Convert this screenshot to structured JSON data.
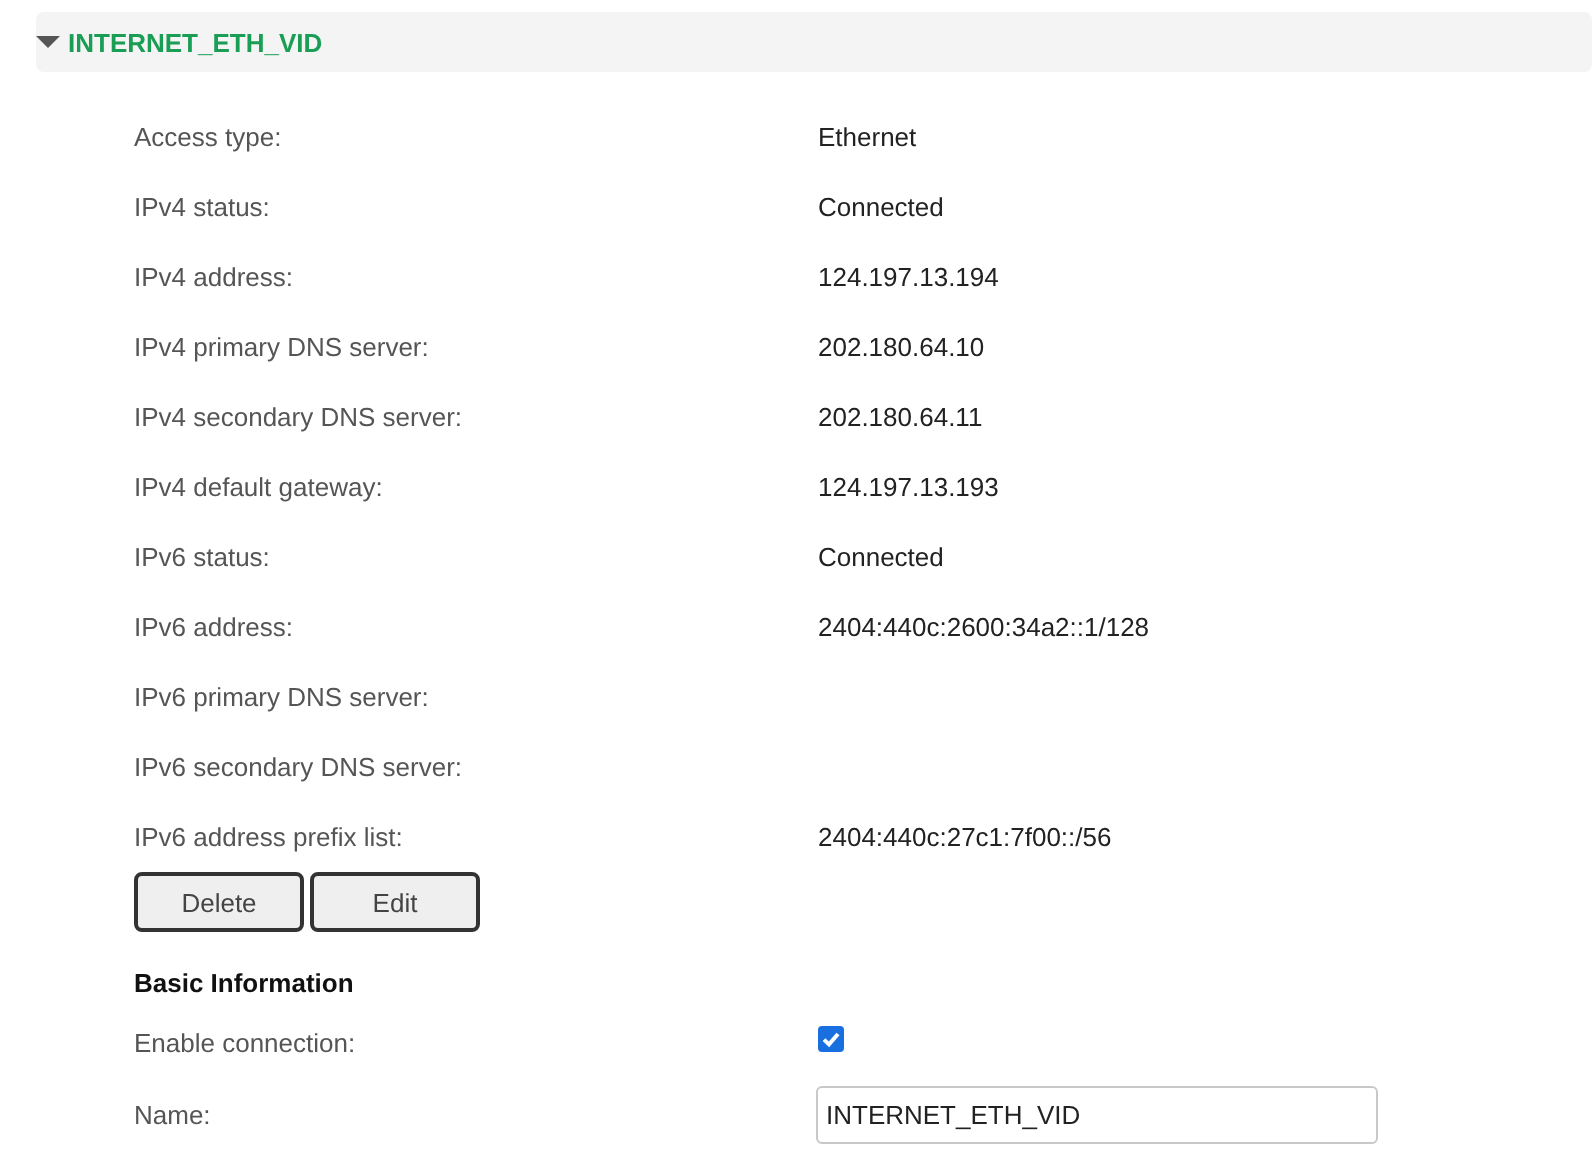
{
  "section": {
    "title": "INTERNET_ETH_VID",
    "expanded": true
  },
  "status_rows": [
    {
      "label": "Access type:",
      "value": "Ethernet"
    },
    {
      "label": "IPv4 status:",
      "value": "Connected"
    },
    {
      "label": "IPv4 address:",
      "value": "124.197.13.194"
    },
    {
      "label": "IPv4 primary DNS server:",
      "value": "202.180.64.10"
    },
    {
      "label": "IPv4 secondary DNS server:",
      "value": "202.180.64.11"
    },
    {
      "label": "IPv4 default gateway:",
      "value": "124.197.13.193"
    },
    {
      "label": "IPv6 status:",
      "value": "Connected"
    },
    {
      "label": "IPv6 address:",
      "value": "2404:440c:2600:34a2::1/128"
    },
    {
      "label": "IPv6 primary DNS server:"
    },
    {
      "label": "IPv6 secondary DNS server:"
    },
    {
      "label": "IPv6 address prefix list:",
      "value": "2404:440c:27c1:7f00::/56"
    }
  ],
  "buttons": [
    "Delete",
    "Edit"
  ],
  "basic_information": {
    "heading": "Basic Information",
    "fields": [
      {
        "kind": "checkbox",
        "label": "Enable connection:",
        "checked": true
      },
      {
        "kind": "text",
        "label": "Name:",
        "value": "INTERNET_ETH_VID"
      }
    ]
  }
}
